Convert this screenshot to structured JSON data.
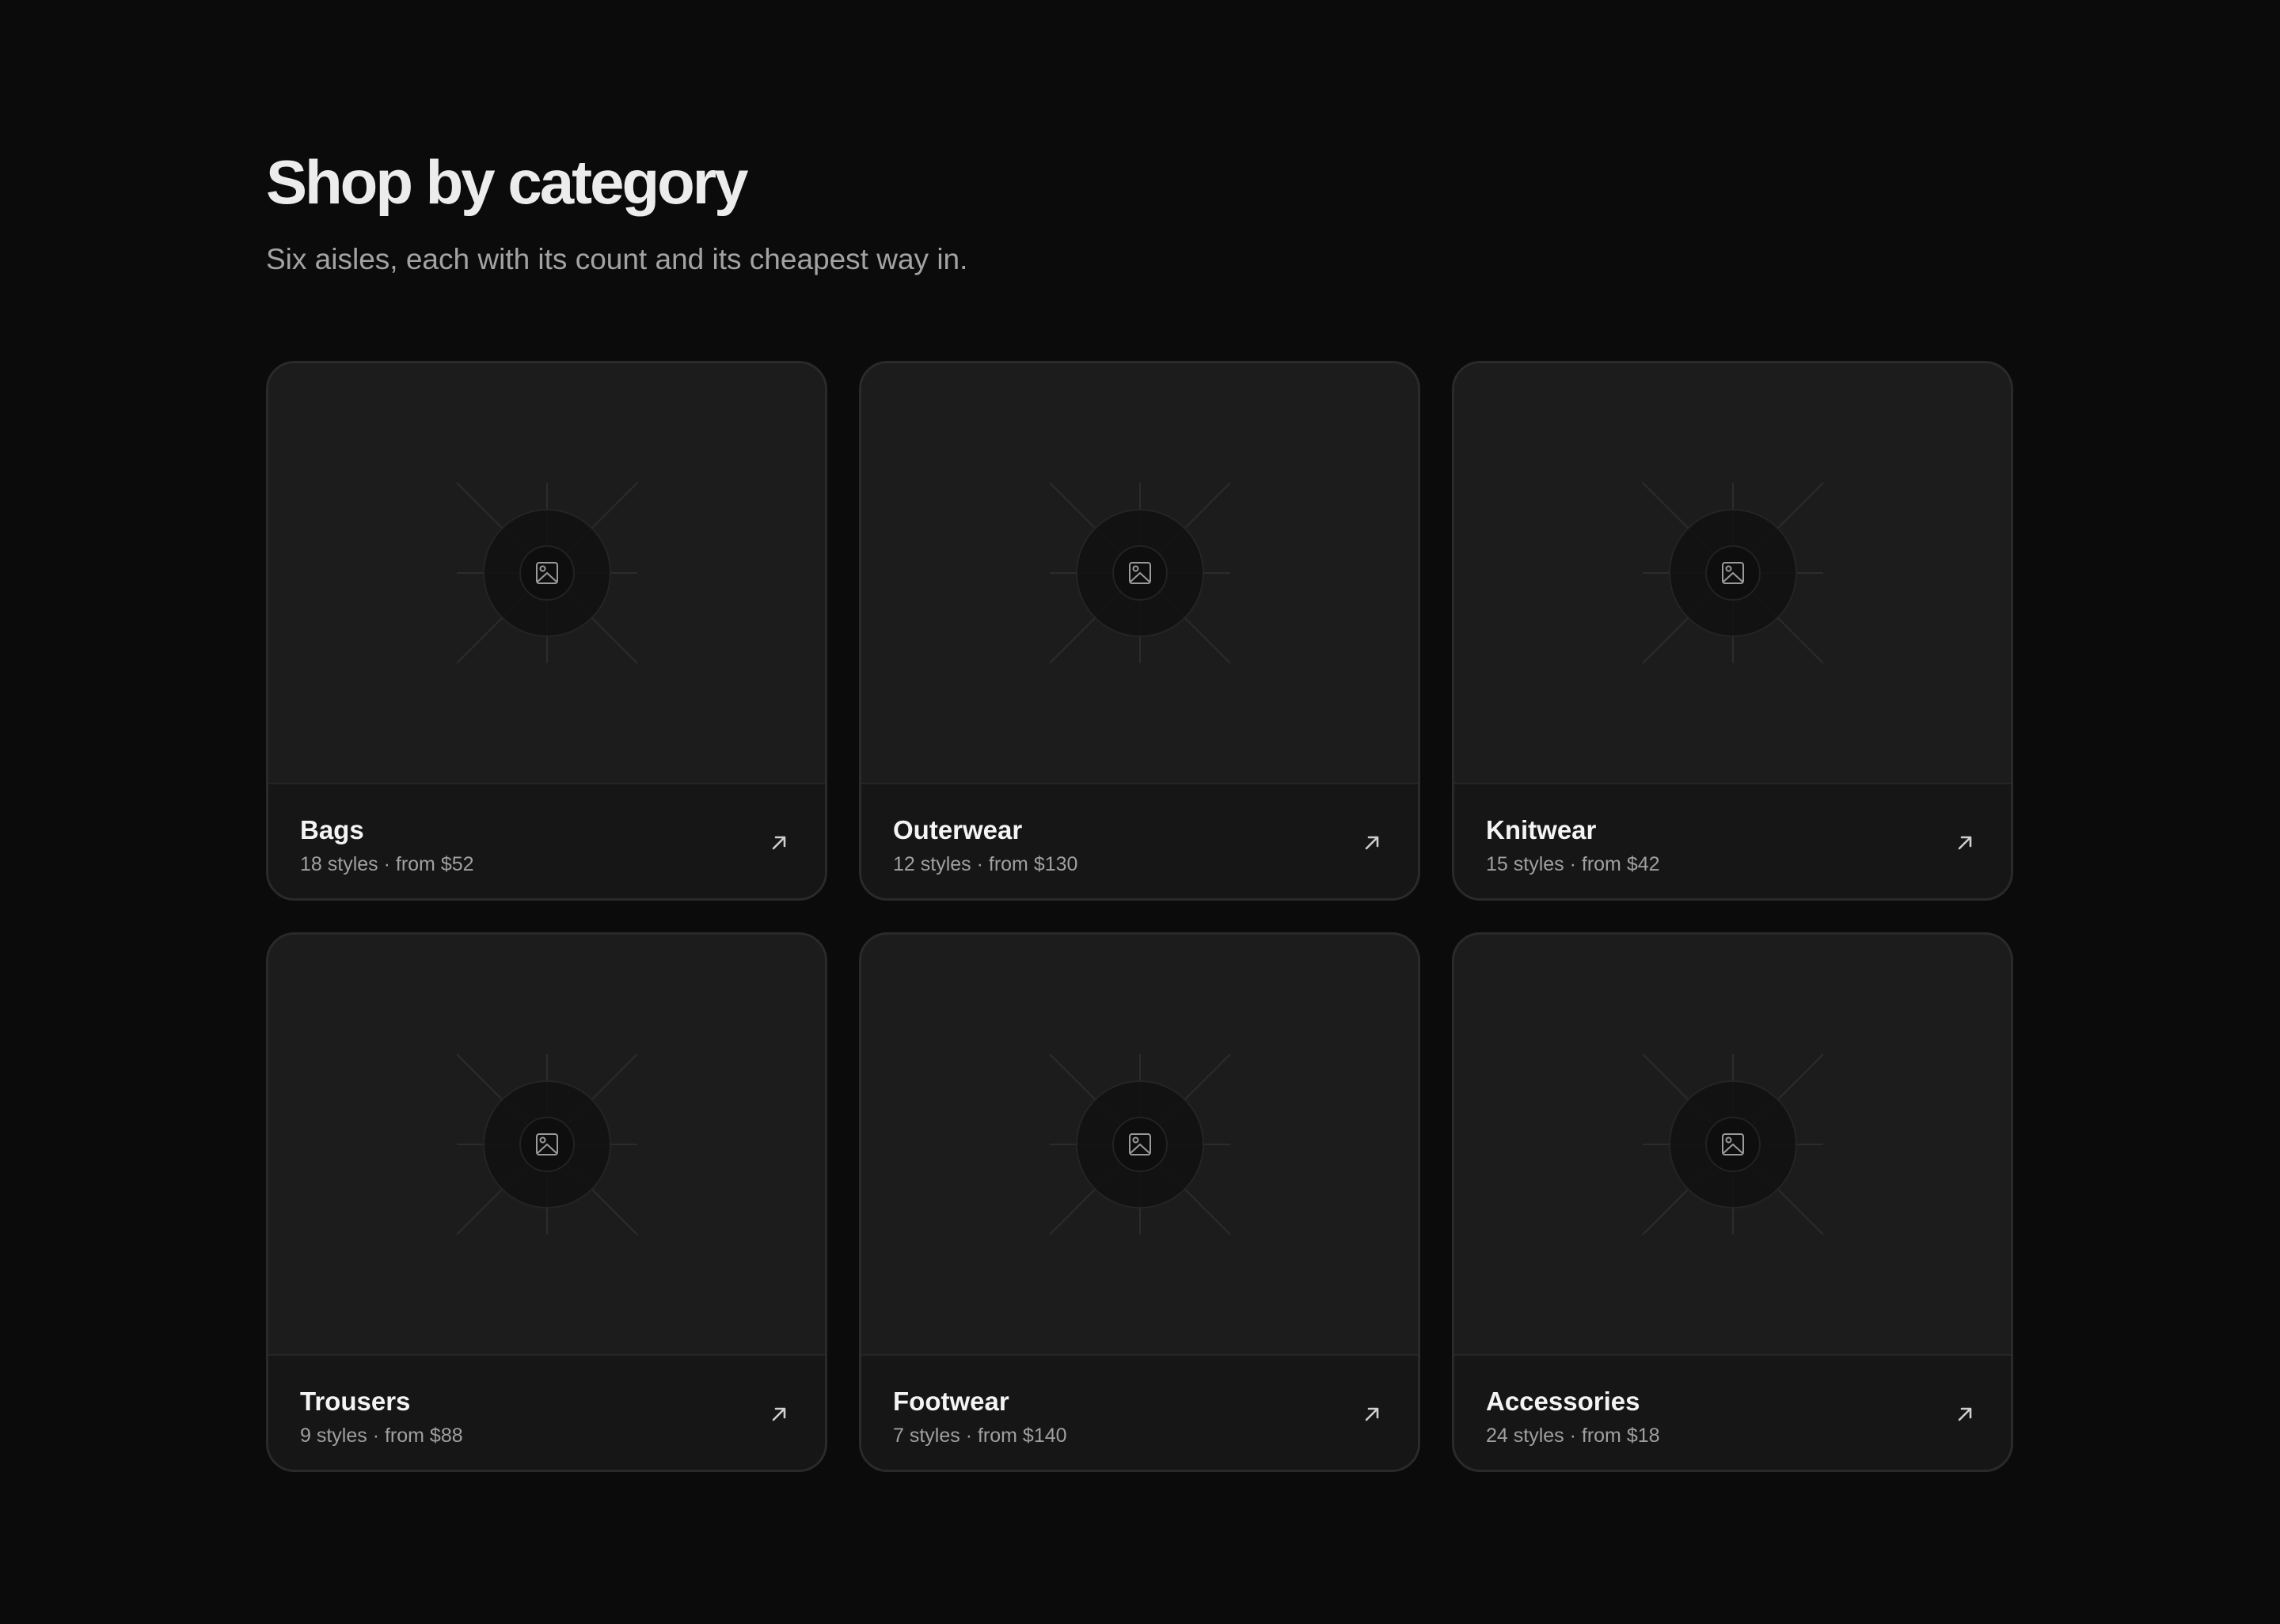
{
  "header": {
    "title": "Shop by category",
    "subtitle": "Six aisles, each with its count and its cheapest way in."
  },
  "icons": {
    "placeholder": "image-icon",
    "card_link": "arrow-up-right-icon"
  },
  "categories": [
    {
      "name": "Bags",
      "meta": "18 styles · from $52"
    },
    {
      "name": "Outerwear",
      "meta": "12 styles · from $130"
    },
    {
      "name": "Knitwear",
      "meta": "15 styles · from $42"
    },
    {
      "name": "Trousers",
      "meta": "9 styles · from $88"
    },
    {
      "name": "Footwear",
      "meta": "7 styles · from $140"
    },
    {
      "name": "Accessories",
      "meta": "24 styles · from $18"
    }
  ]
}
